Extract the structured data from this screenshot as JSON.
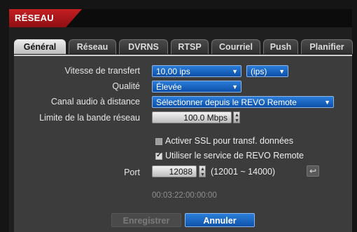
{
  "window": {
    "title": "RÉSEAU"
  },
  "tabs": [
    {
      "label": "Général",
      "active": true
    },
    {
      "label": "Réseau",
      "active": false
    },
    {
      "label": "DVRNS",
      "active": false
    },
    {
      "label": "RTSP",
      "active": false
    },
    {
      "label": "Courriel",
      "active": false
    },
    {
      "label": "Push",
      "active": false
    },
    {
      "label": "Planifier",
      "active": false
    }
  ],
  "form": {
    "vitesse_label": "Vitesse de transfert",
    "vitesse_value": "10,00 ips",
    "vitesse_unit": "(ips)",
    "qualite_label": "Qualité",
    "qualite_value": "Élevée",
    "canal_label": "Canal audio à distance",
    "canal_value": "Sélectionner depuis le REVO Remote",
    "limite_label": "Limite de la bande réseau",
    "limite_value": "100.0 Mbps",
    "ssl_label": "Activer SSL pour transf. données",
    "ssl_checked": false,
    "revo_label": "Utiliser le service de REVO Remote",
    "revo_checked": true,
    "port_label": "Port",
    "port_value": "12088",
    "port_range": "(12001 ~ 14000)",
    "mac_address": "00:03:22:00:00:00"
  },
  "buttons": {
    "save": "Enregistrer",
    "cancel": "Annuler"
  },
  "colors": {
    "accent_red": "#c41f23",
    "accent_blue": "#1a66c4",
    "panel_bg": "#3c3c3c"
  }
}
